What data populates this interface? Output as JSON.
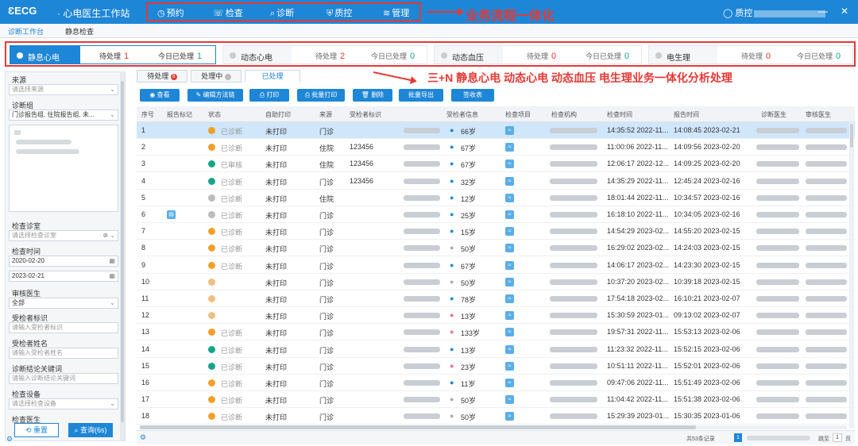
{
  "app": {
    "logo": "ƐECG",
    "title": "· 心电医生工作站",
    "user": "质控"
  },
  "nav": [
    {
      "label": "预约",
      "icon": "clock-icon"
    },
    {
      "label": "检查",
      "icon": "chat-icon"
    },
    {
      "label": "诊断",
      "icon": "search-icon"
    },
    {
      "label": "质控",
      "icon": "shield-icon"
    },
    {
      "label": "管理",
      "icon": "layers-icon"
    }
  ],
  "annotations": {
    "top": "业务流程一体化",
    "mid": "三+N  静息心电 动态心电 动态血压 电生理业务一体化分析处理"
  },
  "subtabs": [
    "诊断工作台",
    "静息检查"
  ],
  "modules": [
    {
      "name": "静息心电",
      "pending_label": "待处理",
      "pending": "1",
      "today_label": "今日已处理",
      "today": "1"
    },
    {
      "name": "动态心电",
      "pending_label": "待处理",
      "pending": "2",
      "today_label": "今日已处理",
      "today": "0"
    },
    {
      "name": "动态血压",
      "pending_label": "待处理",
      "pending": "0",
      "today_label": "今日已处理",
      "today": "0"
    },
    {
      "name": "电生理",
      "pending_label": "待处理",
      "pending": "0",
      "today_label": "今日已处理",
      "today": "0"
    }
  ],
  "filters": {
    "source_label": "来源",
    "source_ph": "请选择来源",
    "group_label": "诊断组",
    "group_val": "门诊报告组, 住院报告组, 未...",
    "room_label": "检查诊室",
    "room_ph": "请选择检查诊室",
    "time_label": "检查时间",
    "time_from": "2020-02-20",
    "time_to": "2023-02-21",
    "reviewer_label": "审核医生",
    "reviewer_val": "全部",
    "pid_label": "受检者标识",
    "pid_ph": "请输入受检者标识",
    "pname_label": "受检者姓名",
    "pname_ph": "请输入受检者姓名",
    "kw_label": "诊断结论关键词",
    "kw_ph": "请输入诊断结论关键词",
    "device_label": "检查设备",
    "device_ph": "请选择检查设备",
    "doctor_label": "检查医生",
    "reset": "重置",
    "query": "查询(6s)"
  },
  "rtabs": [
    "待处理",
    "处理中",
    "已处理"
  ],
  "rtab_badge": "8",
  "toolbar": [
    "查看",
    "编辑方法链",
    "打印",
    "批量打印",
    "删除",
    "批量导出",
    "签收表"
  ],
  "columns": [
    "序号",
    "报告标记",
    "状态",
    "自助打印",
    "来源",
    "受检者标识",
    "",
    "受检者信息",
    "检查项目",
    "检查机构",
    "检查时间",
    "报告时间",
    "诊断医生",
    "审核医生"
  ],
  "rows": [
    {
      "no": "1",
      "status": "已诊断",
      "dot": "#f0a02a",
      "print": "未打印",
      "src": "门诊",
      "pid": "",
      "age": "66岁",
      "sex": "m",
      "exam": "14:35:52 2022-11...",
      "report": "14:08:45 2023-02-21"
    },
    {
      "no": "2",
      "status": "已诊断",
      "dot": "#f0a02a",
      "print": "未打印",
      "src": "住院",
      "pid": "123456",
      "age": "67岁",
      "sex": "m",
      "exam": "11:00:06 2022-11...",
      "report": "14:09:56 2023-02-20"
    },
    {
      "no": "3",
      "status": "已审核",
      "dot": "#17a589",
      "print": "未打印",
      "src": "住院",
      "pid": "123456",
      "age": "67岁",
      "sex": "m",
      "exam": "12:06:17 2022-12...",
      "report": "14:09:25 2023-02-20"
    },
    {
      "no": "4",
      "status": "已诊断",
      "dot": "#17a589",
      "print": "未打印",
      "src": "门诊",
      "pid": "123456",
      "age": "32岁",
      "sex": "m",
      "exam": "14:35:29 2022-11...",
      "report": "12:45:24 2023-02-16"
    },
    {
      "no": "5",
      "status": "已诊断",
      "dot": "#bbbbbb",
      "print": "未打印",
      "src": "住院",
      "pid": "",
      "age": "12岁",
      "sex": "m",
      "exam": "18:01:44 2022-11...",
      "report": "10:34:57 2023-02-16"
    },
    {
      "no": "6",
      "status": "已诊断",
      "dot": "#bbbbbb",
      "print": "未打印",
      "src": "门诊",
      "pid": "",
      "age": "25岁",
      "sex": "m",
      "exam": "16:18:10 2022-11...",
      "report": "10:34:05 2023-02-16"
    },
    {
      "no": "7",
      "status": "已诊断",
      "dot": "#f0a02a",
      "print": "未打印",
      "src": "门诊",
      "pid": "",
      "age": "15岁",
      "sex": "m",
      "exam": "14:54:29 2023-02...",
      "report": "14:55:20 2023-02-15"
    },
    {
      "no": "8",
      "status": "已诊断",
      "dot": "#f0a02a",
      "print": "未打印",
      "src": "门诊",
      "pid": "",
      "age": "50岁",
      "sex": "g",
      "exam": "16:29:02 2023-02...",
      "report": "14:24:03 2023-02-15"
    },
    {
      "no": "9",
      "status": "已诊断",
      "dot": "#f0a02a",
      "print": "未打印",
      "src": "门诊",
      "pid": "",
      "age": "67岁",
      "sex": "m",
      "exam": "14:06:17 2023-02...",
      "report": "14:23:30 2023-02-15"
    },
    {
      "no": "10",
      "status": "",
      "dot": "#f0c080",
      "print": "未打印",
      "src": "门诊",
      "pid": "",
      "age": "50岁",
      "sex": "g",
      "exam": "10:37:20 2023-02...",
      "report": "10:39:18 2023-02-15"
    },
    {
      "no": "11",
      "status": "",
      "dot": "#f0c080",
      "print": "未打印",
      "src": "门诊",
      "pid": "",
      "age": "78岁",
      "sex": "m",
      "exam": "17:54:18 2023-02...",
      "report": "16:10:21 2023-02-07"
    },
    {
      "no": "12",
      "status": "",
      "dot": "#f0c080",
      "print": "未打印",
      "src": "门诊",
      "pid": "",
      "age": "13岁",
      "sex": "f",
      "exam": "15:30:59 2023-01...",
      "report": "09:13:02 2023-02-07"
    },
    {
      "no": "13",
      "status": "已诊断",
      "dot": "#f0a02a",
      "print": "未打印",
      "src": "门诊",
      "pid": "",
      "age": "133岁",
      "sex": "f",
      "exam": "19:57:31 2022-11...",
      "report": "15:53:13 2023-02-06"
    },
    {
      "no": "14",
      "status": "已诊断",
      "dot": "#17a589",
      "print": "未打印",
      "src": "门诊",
      "pid": "",
      "age": "13岁",
      "sex": "m",
      "exam": "11:23:32 2022-11...",
      "report": "15:52:15 2023-02-06"
    },
    {
      "no": "15",
      "status": "已诊断",
      "dot": "#17a589",
      "print": "未打印",
      "src": "门诊",
      "pid": "",
      "age": "23岁",
      "sex": "f",
      "exam": "10:51:11 2022-11...",
      "report": "15:52:01 2023-02-06"
    },
    {
      "no": "16",
      "status": "已诊断",
      "dot": "#f0a02a",
      "print": "未打印",
      "src": "门诊",
      "pid": "",
      "age": "11岁",
      "sex": "m",
      "exam": "09:47:06 2022-11...",
      "report": "15:51:49 2023-02-06"
    },
    {
      "no": "17",
      "status": "已诊断",
      "dot": "#f0a02a",
      "print": "未打印",
      "src": "门诊",
      "pid": "",
      "age": "50岁",
      "sex": "g",
      "exam": "11:04:42 2022-11...",
      "report": "15:51:38 2023-02-06"
    },
    {
      "no": "18",
      "status": "已诊断",
      "dot": "#f0a02a",
      "print": "未打印",
      "src": "门诊",
      "pid": "",
      "age": "50岁",
      "sex": "g",
      "exam": "15:29:39 2023-01...",
      "report": "15:30:35 2023-01-06"
    }
  ],
  "footer": {
    "total": "共53条记录",
    "goto": "跳至",
    "page": "1",
    "unit": "页"
  },
  "colors": {
    "primary": "#1e86d6",
    "annotation": "#e53935",
    "selected_row": "#cfe6fb"
  }
}
